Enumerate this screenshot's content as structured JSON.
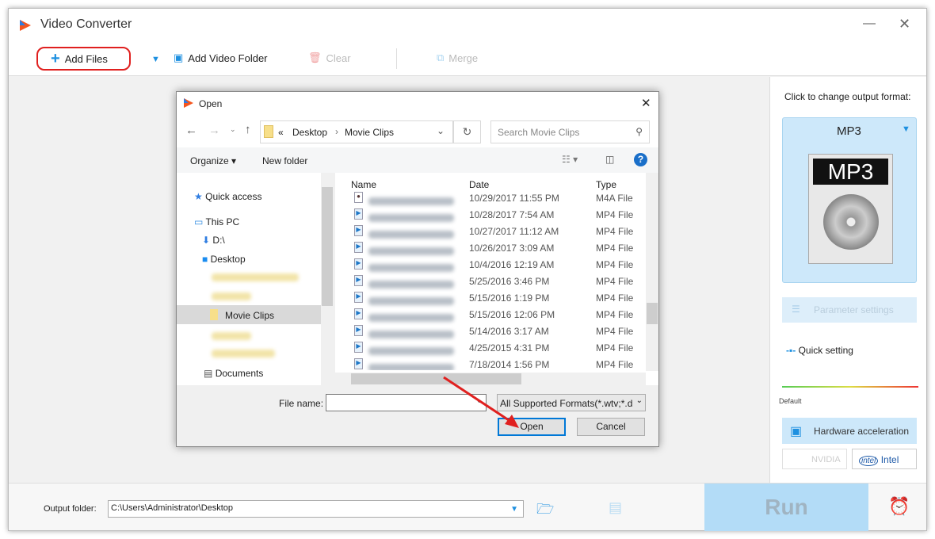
{
  "app": {
    "title": "Video Converter"
  },
  "toolbar": {
    "add_files": "Add Files",
    "add_video_folder": "Add Video Folder",
    "clear": "Clear",
    "merge": "Merge"
  },
  "dialog": {
    "title": "Open",
    "breadcrumb": {
      "prefix": "«",
      "items": [
        "Desktop",
        "Movie Clips"
      ]
    },
    "search_placeholder": "Search Movie Clips",
    "organize": "Organize",
    "new_folder": "New folder",
    "nav": [
      {
        "label": "Quick access",
        "icon": "star-icon"
      },
      {
        "label": "This PC",
        "icon": "monitor-icon"
      },
      {
        "label": "D:\\",
        "icon": "download-icon"
      },
      {
        "label": "Desktop",
        "icon": "desktop-icon"
      },
      {
        "label": "Movie Clips",
        "icon": "folder-icon",
        "selected": true
      },
      {
        "label": "Documents",
        "icon": "document-icon"
      }
    ],
    "columns": [
      "Name",
      "Date",
      "Type"
    ],
    "files": [
      {
        "date": "10/29/2017 11:55 PM",
        "type": "M4A File"
      },
      {
        "date": "10/28/2017 7:54 AM",
        "type": "MP4 File"
      },
      {
        "date": "10/27/2017 11:12 AM",
        "type": "MP4 File"
      },
      {
        "date": "10/26/2017 3:09 AM",
        "type": "MP4 File"
      },
      {
        "date": "10/4/2016 12:19 AM",
        "type": "MP4 File"
      },
      {
        "date": "5/25/2016 3:46 PM",
        "type": "MP4 File"
      },
      {
        "date": "5/15/2016 1:19 PM",
        "type": "MP4 File"
      },
      {
        "date": "5/15/2016 12:06 PM",
        "type": "MP4 File"
      },
      {
        "date": "5/14/2016 3:17 AM",
        "type": "MP4 File"
      },
      {
        "date": "4/25/2015 4:31 PM",
        "type": "MP4 File"
      },
      {
        "date": "7/18/2014 1:56 PM",
        "type": "MP4 File"
      }
    ],
    "file_name_label": "File name:",
    "file_name_value": "",
    "filter": "All Supported Formats(*.wtv;*.d",
    "open": "Open",
    "cancel": "Cancel"
  },
  "right": {
    "hint": "Click to change output format:",
    "format": "MP3",
    "format_badge": "MP3",
    "param": "Parameter settings",
    "quick": "Quick setting",
    "default": "Default",
    "hw": "Hardware acceleration",
    "nvidia": "NVIDIA",
    "intel": "Intel",
    "intel_logo": "intel"
  },
  "bottom": {
    "label": "Output folder:",
    "path": "C:\\Users\\Administrator\\Desktop",
    "run": "Run"
  },
  "colors": {
    "accent": "#1e90e0",
    "highlight": "#e02020",
    "run_bg": "#b3dcf7"
  }
}
